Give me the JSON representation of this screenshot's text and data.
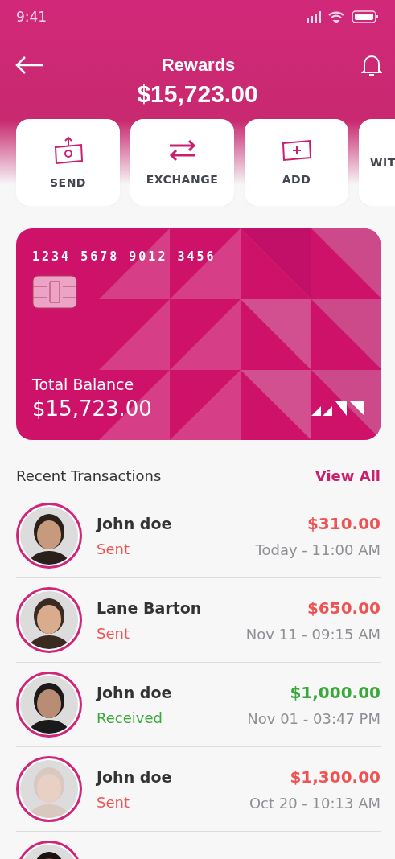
{
  "status_bar": {
    "time": "9:41"
  },
  "header": {
    "title": "Rewards",
    "balance": "$15,723.00"
  },
  "actions": [
    {
      "label": "SEND",
      "kind": "send"
    },
    {
      "label": "EXCHANGE",
      "kind": "exchange"
    },
    {
      "label": "ADD",
      "kind": "add"
    },
    {
      "label": "WIT",
      "kind": "withdraw"
    }
  ],
  "card": {
    "number": "1234 5678 9012 3456",
    "balance_label": "Total Balance",
    "balance": "$15,723.00"
  },
  "transactions_section": {
    "title": "Recent Transactions",
    "link": "View All"
  },
  "transactions": [
    {
      "kind": "sent",
      "name": "John doe",
      "status": "Sent",
      "amount": "$310.00",
      "date": "Today - 11:00 AM"
    },
    {
      "kind": "sent",
      "name": "Lane Barton",
      "status": "Sent",
      "amount": "$650.00",
      "date": "Nov 11 - 09:15 AM"
    },
    {
      "kind": "received",
      "name": "John doe",
      "status": "Received",
      "amount": "$1,000.00",
      "date": "Nov 01 - 03:47 PM"
    },
    {
      "kind": "sent",
      "name": "John doe",
      "status": "Sent",
      "amount": "$1,300.00",
      "date": "Oct 20 - 10:13 AM"
    },
    {
      "kind": "partial"
    }
  ]
}
